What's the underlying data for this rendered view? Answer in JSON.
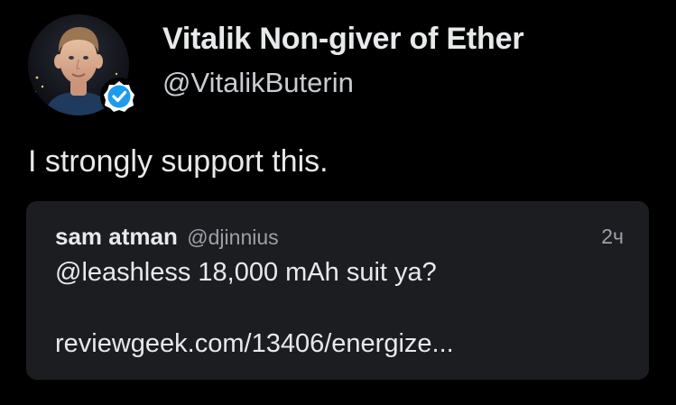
{
  "tweet": {
    "author": {
      "display_name": "Vitalik Non-giver of Ether",
      "handle": "@VitalikButerin",
      "verified": true,
      "avatar_icon": "profile-photo",
      "badge_icon": "verified-check-icon",
      "badge_color": "#1d9bf0"
    },
    "text": "I strongly support this.",
    "quoted": {
      "display_name": "sam atman",
      "handle": "@djinnius",
      "time": "2ч",
      "text_line1": "@leashless 18,000 mAh suit ya?",
      "text_line2": "reviewgeek.com/13406/energize..."
    }
  },
  "colors": {
    "background": "#000000",
    "card": "#1c1d21",
    "primary_text": "#e7e9ea",
    "secondary_text": "#9ca1a8"
  }
}
